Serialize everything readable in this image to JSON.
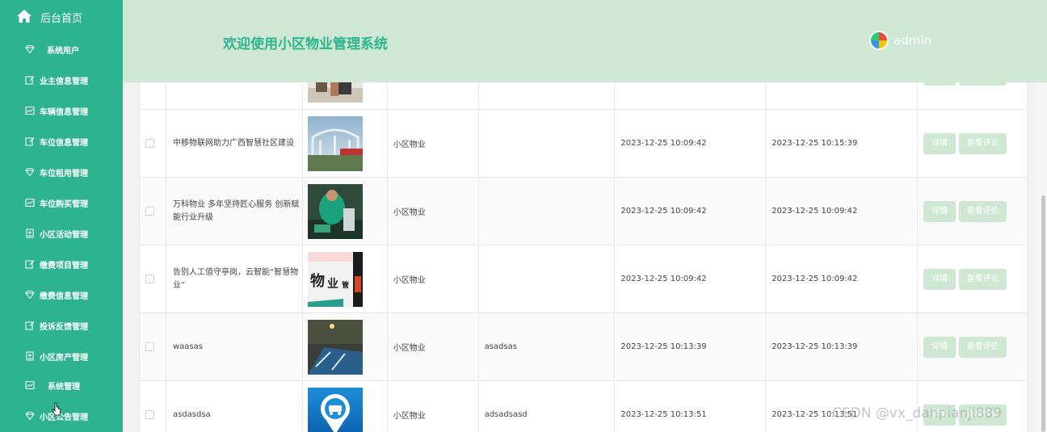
{
  "sidebar": {
    "home_label": "后台首页",
    "items": [
      {
        "label": "系统用户",
        "icon": "gem-icon"
      },
      {
        "label": "业主信息管理",
        "icon": "edit-icon"
      },
      {
        "label": "车辆信息管理",
        "icon": "chart-icon"
      },
      {
        "label": "车位信息管理",
        "icon": "edit-icon"
      },
      {
        "label": "车位租用管理",
        "icon": "gem-icon"
      },
      {
        "label": "车位购买管理",
        "icon": "chart-icon"
      },
      {
        "label": "小区活动管理",
        "icon": "id-card-icon"
      },
      {
        "label": "缴费项目管理",
        "icon": "edit-icon"
      },
      {
        "label": "缴费信息管理",
        "icon": "gem-icon"
      },
      {
        "label": "投诉反馈管理",
        "icon": "edit-icon"
      },
      {
        "label": "小区房产管理",
        "icon": "id-card-icon"
      },
      {
        "label": "系统管理",
        "icon": "chart-icon"
      },
      {
        "label": "小区公告管理",
        "icon": "gem-icon"
      }
    ]
  },
  "header": {
    "title": "欢迎使用小区物业管理系统",
    "username": "admin"
  },
  "table": {
    "rows": [
      {
        "title": "",
        "type": "",
        "text": "",
        "created": "",
        "updated": "",
        "img": "people"
      },
      {
        "title": "中移物联网助力广西智慧社区建设",
        "type": "小区物业",
        "text": "",
        "created": "2023-12-25 10:09:42",
        "updated": "2023-12-25 10:15:39",
        "img": "park"
      },
      {
        "title": "万科物业 多年坚持匠心服务 创新赋能行业升级",
        "type": "小区物业",
        "text": "",
        "created": "2023-12-25 10:09:42",
        "updated": "2023-12-25 10:09:42",
        "img": "worker"
      },
      {
        "title": "告别人工值守亭岗，云智能“智慧物业”",
        "type": "小区物业",
        "text": "",
        "created": "2023-12-25 10:09:42",
        "updated": "2023-12-25 10:09:42",
        "img": "sign"
      },
      {
        "title": "waasas",
        "type": "小区物业",
        "text": "asadsas",
        "created": "2023-12-25 10:13:39",
        "updated": "2023-12-25 10:13:39",
        "img": "night"
      },
      {
        "title": "asdasdsa",
        "type": "小区物业",
        "text": "adsadsasd",
        "created": "2023-12-25 10:13:51",
        "updated": "2023-12-25 10:13:51",
        "img": "pin"
      }
    ],
    "detail_label": "详情",
    "comment_label": "查看评论"
  },
  "watermark": "CSDN @vx_danpianji889",
  "colors": {
    "sidebar_bg": "#2db38f",
    "header_bg": "#cfe8d3",
    "accent": "#2db38f",
    "button_bg": "#cfe8d3"
  }
}
